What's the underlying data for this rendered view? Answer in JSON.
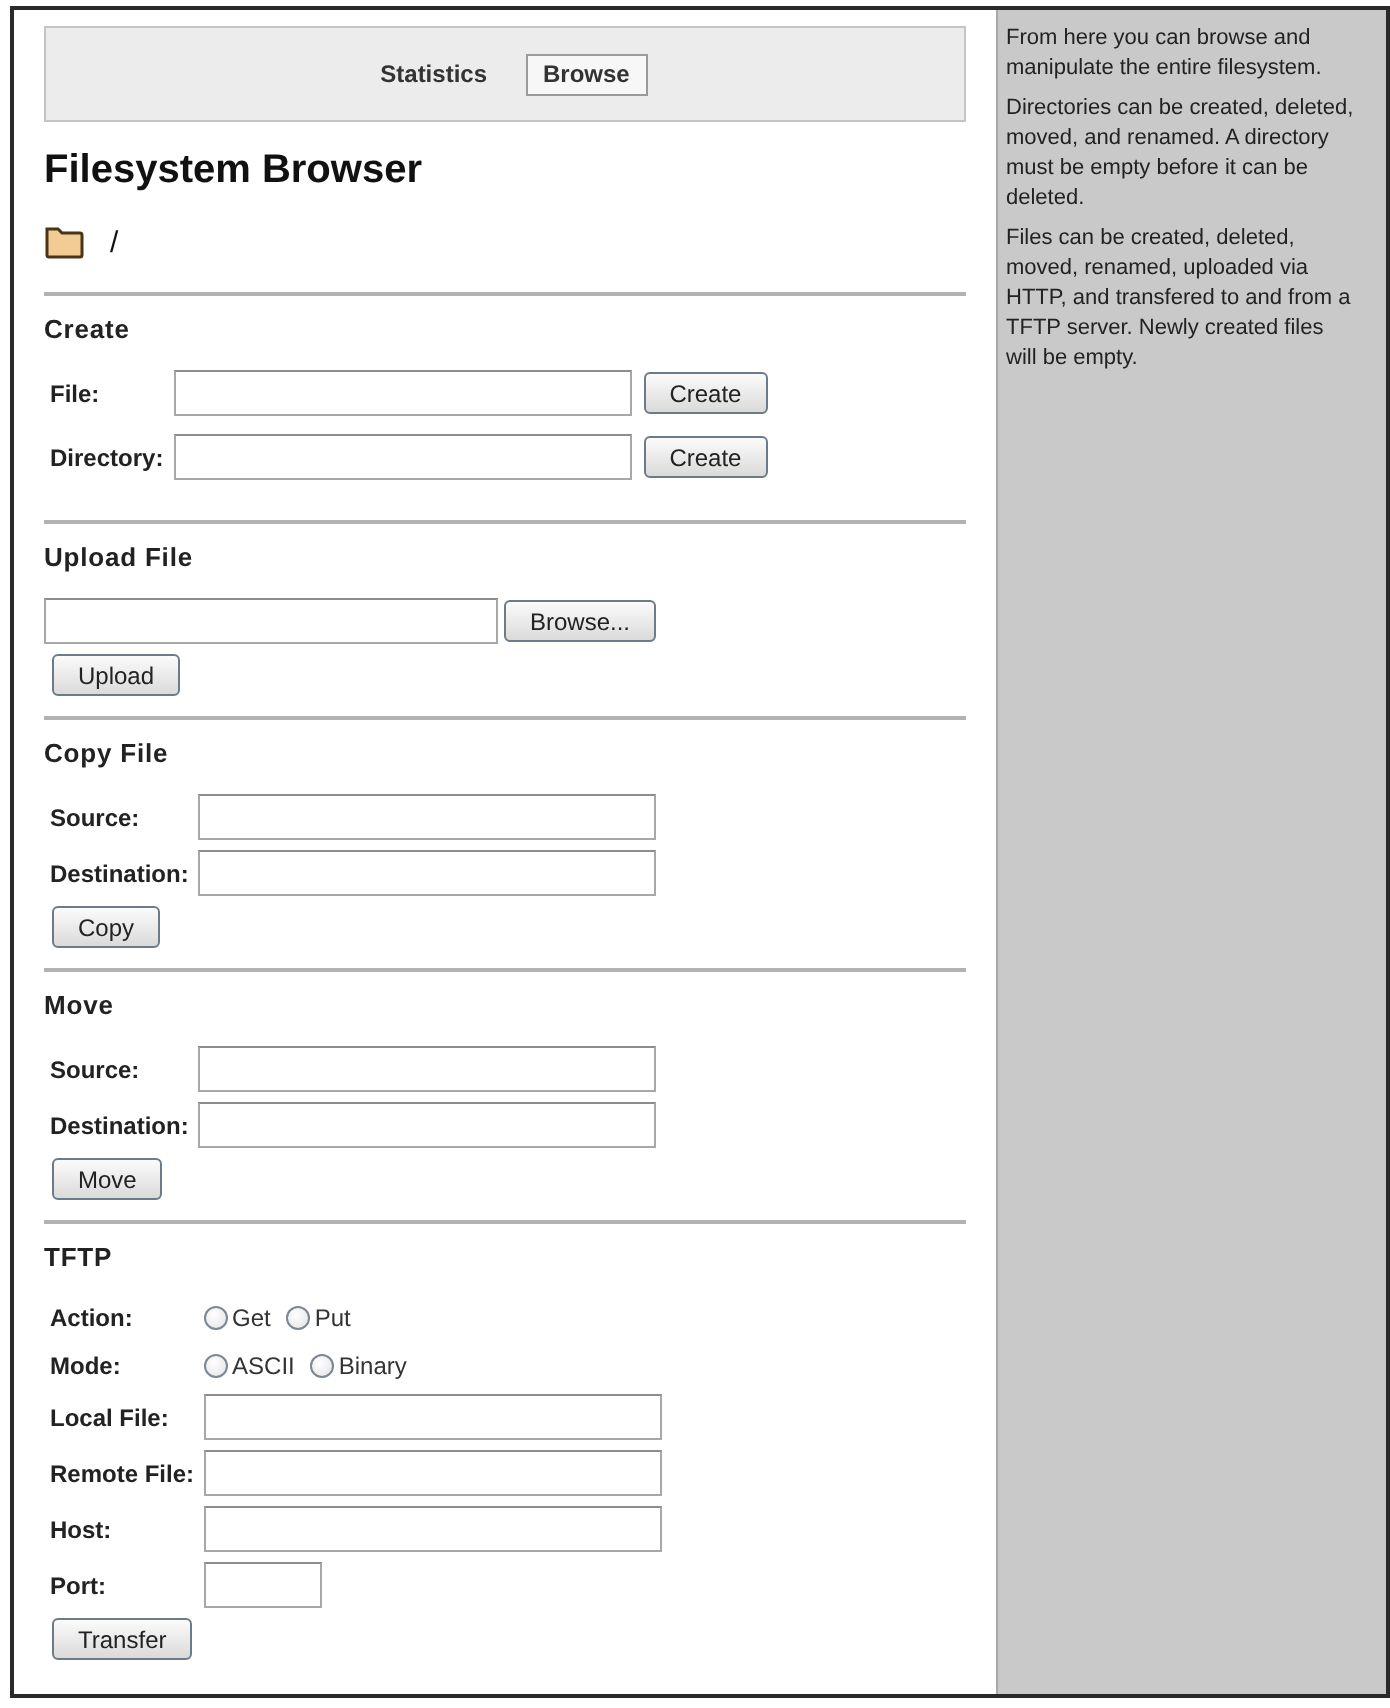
{
  "nav": {
    "items": [
      {
        "label": "Statistics",
        "selected": false
      },
      {
        "label": "Browse",
        "selected": true
      }
    ]
  },
  "title": "Filesystem Browser",
  "path": "/",
  "sections": [
    {
      "heading": "Create",
      "rows": [
        {
          "kind": "field_button",
          "label": "File:",
          "button": "Create"
        },
        {
          "kind": "field_button",
          "label": "Directory:",
          "button": "Create"
        }
      ]
    },
    {
      "heading": "Upload File",
      "rows": [
        {
          "kind": "file",
          "button": "Browse..."
        }
      ],
      "button": "Upload"
    },
    {
      "heading": "Copy File",
      "rows": [
        {
          "kind": "field",
          "label": "Source:"
        },
        {
          "kind": "field",
          "label": "Destination:"
        }
      ],
      "button": "Copy"
    },
    {
      "heading": "Move",
      "rows": [
        {
          "kind": "field",
          "label": "Source:"
        },
        {
          "kind": "field",
          "label": "Destination:"
        }
      ],
      "button": "Move"
    },
    {
      "heading": "TFTP",
      "rows": [
        {
          "kind": "radio",
          "label": "Action:",
          "options": [
            {
              "label": "Get",
              "selected": false
            },
            {
              "label": "Put",
              "selected": false
            }
          ]
        },
        {
          "kind": "radio",
          "label": "Mode:",
          "options": [
            {
              "label": "ASCII",
              "selected": false
            },
            {
              "label": "Binary",
              "selected": false
            }
          ]
        },
        {
          "kind": "field",
          "label": "Local File:"
        },
        {
          "kind": "field",
          "label": "Remote File:"
        },
        {
          "kind": "field",
          "label": "Host:"
        },
        {
          "kind": "short_field",
          "label": "Port:"
        }
      ],
      "button": "Transfer"
    }
  ],
  "sidebar": {
    "paragraphs": [
      "From here you can browse and manipulate the entire filesystem.",
      "Directories can be created, deleted, moved, and renamed. A directory must be empty before it can be deleted.",
      "Files can be created, deleted, moved, renamed, uploaded via HTTP, and transfered to and from a TFTP server. Newly created files will be empty."
    ]
  }
}
